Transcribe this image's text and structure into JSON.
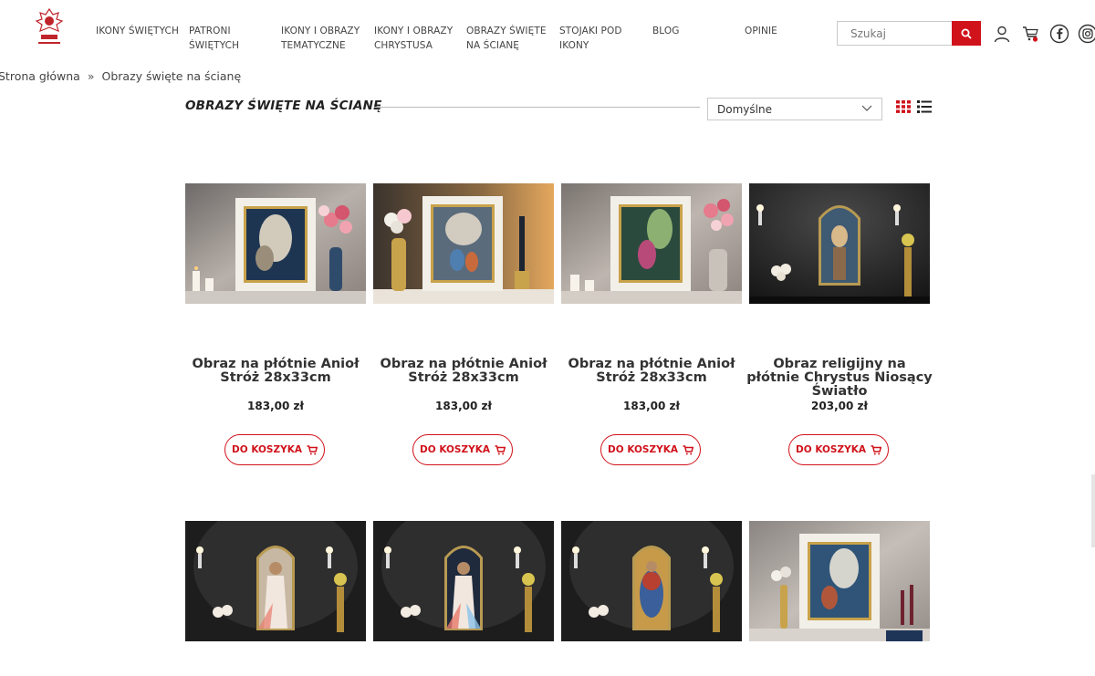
{
  "header": {
    "nav": [
      {
        "label": "IKONY ŚWIĘTYCH"
      },
      {
        "label": "PATRONI ŚWIĘTYCH"
      },
      {
        "label": "IKONY I OBRAZY TEMATYCZNE"
      },
      {
        "label": "IKONY I OBRAZY CHRYSTUSA"
      },
      {
        "label": "OBRAZY ŚWIĘTE NA ŚCIANĘ"
      },
      {
        "label": "STOJAKI POD IKONY"
      },
      {
        "label": "BLOG"
      },
      {
        "label": "OPINIE"
      }
    ],
    "search": {
      "placeholder": "Szukaj"
    },
    "icons": [
      "user-icon",
      "cart-icon",
      "facebook-icon",
      "instagram-icon"
    ],
    "accent": "#d0121b"
  },
  "breadcrumb": {
    "home": "Strona główna",
    "separator": "»",
    "current": "Obrazy święte na ścianę"
  },
  "page": {
    "title": "OBRAZY ŚWIĘTE NA ŚCIANĘ"
  },
  "sort": {
    "selected": "Domyślne"
  },
  "products": [
    {
      "name": "Obraz na płótnie Anioł Stróż 28x33cm",
      "price": "183,00 zł",
      "button": "DO KOSZYKA"
    },
    {
      "name": "Obraz na płótnie Anioł Stróż 28x33cm",
      "price": "183,00 zł",
      "button": "DO KOSZYKA"
    },
    {
      "name": "Obraz na płótnie Anioł Stróż 28x33cm",
      "price": "183,00 zł",
      "button": "DO KOSZYKA"
    },
    {
      "name": "Obraz religijny na płótnie Chrystus Niosący Światło",
      "price": "203,00 zł",
      "button": "DO KOSZYKA"
    }
  ]
}
